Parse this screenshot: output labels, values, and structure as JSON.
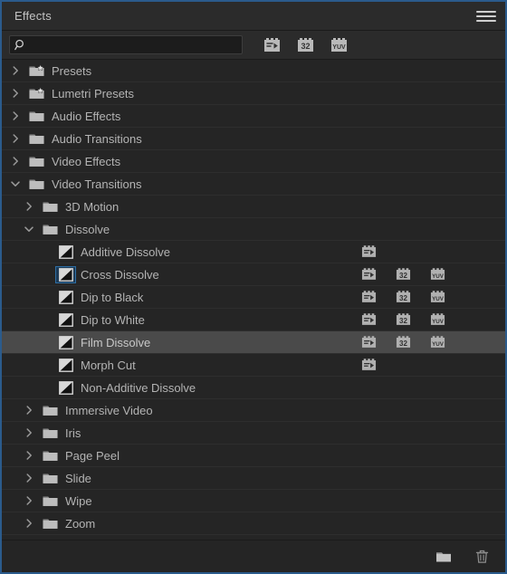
{
  "panel": {
    "title": "Effects",
    "menu_icon": "hamburger-menu-icon"
  },
  "search": {
    "icon": "search-icon",
    "value": "",
    "placeholder": ""
  },
  "filters": [
    {
      "name": "accelerated-effects-filter",
      "label": "Accelerated Effects",
      "glyph": "accelerated"
    },
    {
      "name": "32-bit-color-filter",
      "label": "32-bit Color",
      "glyph": "32"
    },
    {
      "name": "yuv-color-filter",
      "label": "YUV Color",
      "glyph": "YUV"
    }
  ],
  "footer": {
    "new_bin_label": "New Custom Bin",
    "delete_label": "Delete Custom Item"
  },
  "colors": {
    "panel_background": "#252525",
    "header_background": "#2b2b2b",
    "selection_row": "#4a4a4a",
    "focus_border": "#2b5b8c",
    "default_transition_highlight": "#2d6da3",
    "text": "#b4b4b4"
  },
  "tree": [
    {
      "label": "Presets",
      "depth": 0,
      "type": "folder-preset",
      "expanded": false,
      "selected": false,
      "badges": []
    },
    {
      "label": "Lumetri Presets",
      "depth": 0,
      "type": "folder-preset",
      "expanded": false,
      "selected": false,
      "badges": []
    },
    {
      "label": "Audio Effects",
      "depth": 0,
      "type": "folder",
      "expanded": false,
      "selected": false,
      "badges": []
    },
    {
      "label": "Audio Transitions",
      "depth": 0,
      "type": "folder",
      "expanded": false,
      "selected": false,
      "badges": []
    },
    {
      "label": "Video Effects",
      "depth": 0,
      "type": "folder",
      "expanded": false,
      "selected": false,
      "badges": []
    },
    {
      "label": "Video Transitions",
      "depth": 0,
      "type": "folder",
      "expanded": true,
      "selected": false,
      "badges": []
    },
    {
      "label": "3D Motion",
      "depth": 1,
      "type": "folder",
      "expanded": false,
      "selected": false,
      "badges": []
    },
    {
      "label": "Dissolve",
      "depth": 1,
      "type": "folder",
      "expanded": true,
      "selected": false,
      "badges": []
    },
    {
      "label": "Additive Dissolve",
      "depth": 2,
      "type": "transition",
      "selected": false,
      "default": false,
      "badges": [
        "accelerated"
      ]
    },
    {
      "label": "Cross Dissolve",
      "depth": 2,
      "type": "transition",
      "selected": false,
      "default": true,
      "badges": [
        "accelerated",
        "32",
        "YUV"
      ]
    },
    {
      "label": "Dip to Black",
      "depth": 2,
      "type": "transition",
      "selected": false,
      "default": false,
      "badges": [
        "accelerated",
        "32",
        "YUV"
      ]
    },
    {
      "label": "Dip to White",
      "depth": 2,
      "type": "transition",
      "selected": false,
      "default": false,
      "badges": [
        "accelerated",
        "32",
        "YUV"
      ]
    },
    {
      "label": "Film Dissolve",
      "depth": 2,
      "type": "transition",
      "selected": true,
      "default": false,
      "badges": [
        "accelerated",
        "32",
        "YUV"
      ]
    },
    {
      "label": "Morph Cut",
      "depth": 2,
      "type": "transition",
      "selected": false,
      "default": false,
      "badges": [
        "accelerated"
      ]
    },
    {
      "label": "Non-Additive Dissolve",
      "depth": 2,
      "type": "transition",
      "selected": false,
      "default": false,
      "badges": []
    },
    {
      "label": "Immersive Video",
      "depth": 1,
      "type": "folder",
      "expanded": false,
      "selected": false,
      "badges": []
    },
    {
      "label": "Iris",
      "depth": 1,
      "type": "folder",
      "expanded": false,
      "selected": false,
      "badges": []
    },
    {
      "label": "Page Peel",
      "depth": 1,
      "type": "folder",
      "expanded": false,
      "selected": false,
      "badges": []
    },
    {
      "label": "Slide",
      "depth": 1,
      "type": "folder",
      "expanded": false,
      "selected": false,
      "badges": []
    },
    {
      "label": "Wipe",
      "depth": 1,
      "type": "folder",
      "expanded": false,
      "selected": false,
      "badges": []
    },
    {
      "label": "Zoom",
      "depth": 1,
      "type": "folder",
      "expanded": false,
      "selected": false,
      "badges": []
    }
  ]
}
